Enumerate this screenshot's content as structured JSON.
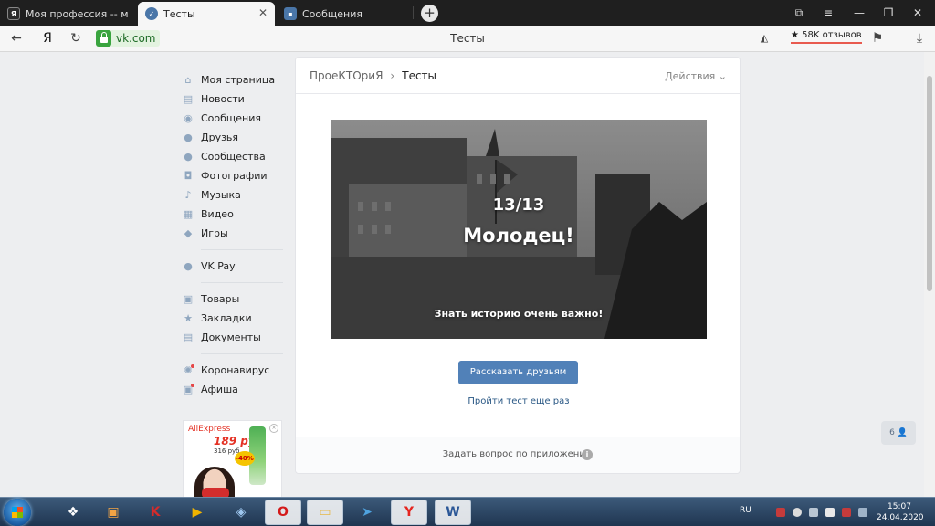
{
  "browser": {
    "tabs": [
      {
        "title": "Моя профессия -- моя ис",
        "active": false
      },
      {
        "title": "Тесты",
        "active": true
      },
      {
        "title": "Сообщения",
        "active": false
      }
    ],
    "new_tab_label": "+",
    "back_icon": "←",
    "yandex_icon": "Я",
    "reload_icon": "↻",
    "url_domain": "vk.com",
    "page_title": "Тесты",
    "reviews_label": "★ 58K отзывов"
  },
  "sidebar": {
    "items": [
      {
        "label": "Моя страница",
        "icon": "⌂"
      },
      {
        "label": "Новости",
        "icon": "▤"
      },
      {
        "label": "Сообщения",
        "icon": "◉"
      },
      {
        "label": "Друзья",
        "icon": "●"
      },
      {
        "label": "Сообщества",
        "icon": "●"
      },
      {
        "label": "Фотографии",
        "icon": "◘"
      },
      {
        "label": "Музыка",
        "icon": "♪"
      },
      {
        "label": "Видео",
        "icon": "▦"
      },
      {
        "label": "Игры",
        "icon": "◆"
      }
    ],
    "pay": {
      "label": "VK Pay",
      "icon": "●"
    },
    "items2": [
      {
        "label": "Товары",
        "icon": "▣"
      },
      {
        "label": "Закладки",
        "icon": "★"
      },
      {
        "label": "Документы",
        "icon": "▤"
      }
    ],
    "items3": [
      {
        "label": "Коронавирус",
        "icon": "✺"
      },
      {
        "label": "Афиша",
        "icon": "▣"
      }
    ]
  },
  "ad": {
    "brand": "AliExpress",
    "price": "189 руб.",
    "old_price": "316 руб.",
    "discount": "-40%",
    "close_icon": "×"
  },
  "content": {
    "app_name": "ПроеКТОриЯ",
    "crumb_sep": "›",
    "current": "Тесты",
    "actions_label": "Действия ⌄",
    "score": "13/13",
    "verdict": "Молодец!",
    "motto": "Знать историю очень важно!",
    "share_button": "Рассказать друзьям",
    "retry_link": "Пройти тест еще раз",
    "footer_text": "Задать вопрос по приложению",
    "info_icon": "i"
  },
  "chat_badge": "6 👤",
  "taskbar": {
    "lang": "RU",
    "time": "15:07",
    "date": "24.04.2020"
  }
}
